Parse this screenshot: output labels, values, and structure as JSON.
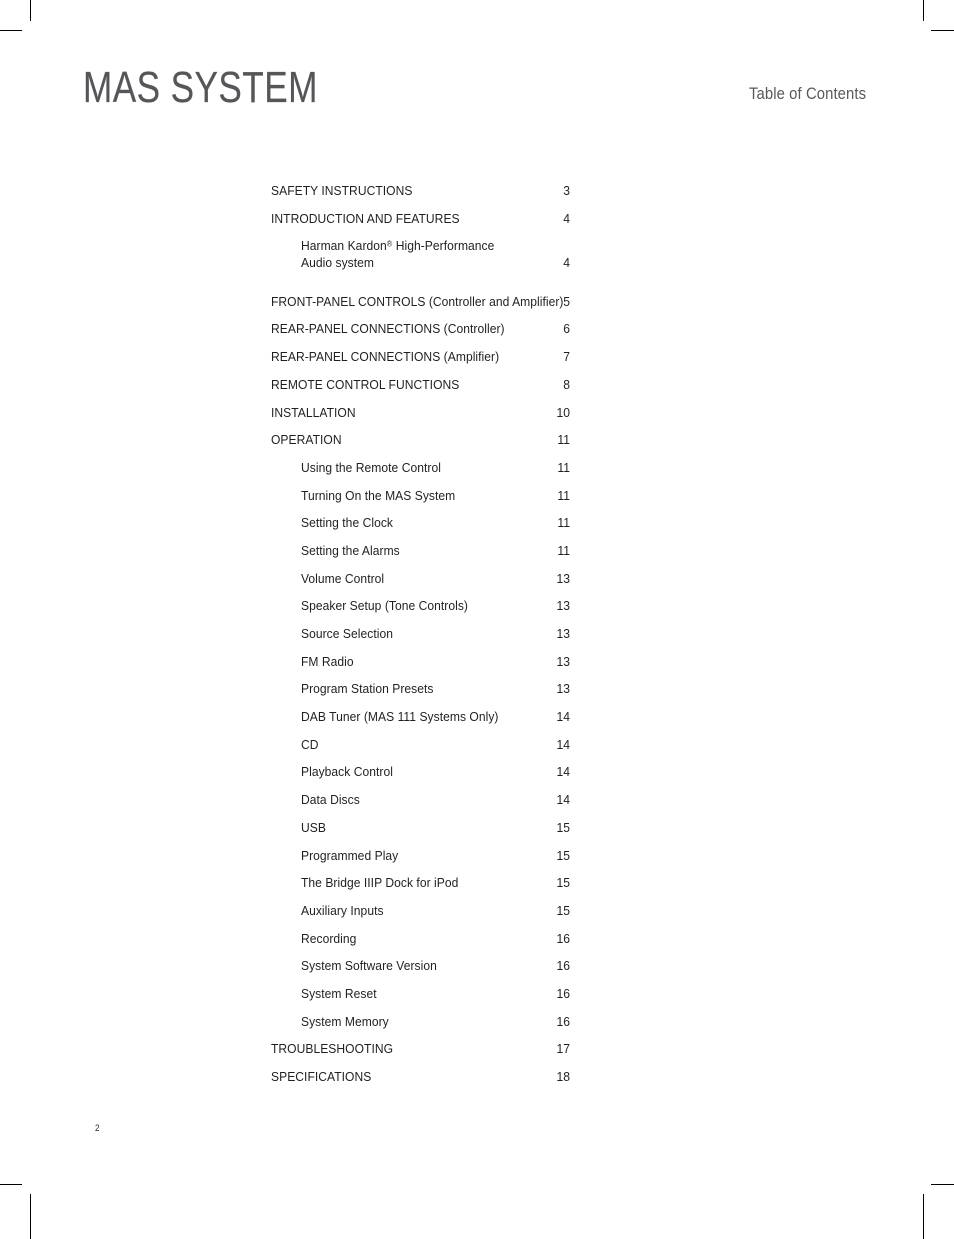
{
  "document": {
    "brand_title": "MAS SYSTEM",
    "section_kicker": "Table of Contents",
    "folio": "2"
  },
  "toc": {
    "entries": [
      {
        "label": "SAFETY INSTRUCTIONS",
        "page": "3",
        "level": "main",
        "lines": 1
      },
      {
        "label": "INTRODUCTION AND FEATURES",
        "page": "4",
        "level": "main",
        "lines": 1
      },
      {
        "label": "Harman Kardon<sup>®</sup> High-Performance\nAudio system",
        "page": "4",
        "level": "sub",
        "lines": 2
      },
      {
        "label": "FRONT-PANEL CONTROLS (Controller and Amplifier)",
        "page": "5",
        "level": "main",
        "lines": 1
      },
      {
        "label": "REAR-PANEL CONNECTIONS (Controller)",
        "page": "6",
        "level": "main",
        "lines": 1
      },
      {
        "label": "REAR-PANEL CONNECTIONS (Amplifier)",
        "page": "7",
        "level": "main",
        "lines": 1
      },
      {
        "label": "REMOTE CONTROL FUNCTIONS",
        "page": "8",
        "level": "main",
        "lines": 1
      },
      {
        "label": "INSTALLATION",
        "page": "10",
        "level": "main",
        "lines": 1
      },
      {
        "label": "OPERATION",
        "page": "11",
        "level": "main",
        "lines": 1
      },
      {
        "label": "Using the Remote Control",
        "page": "11",
        "level": "sub",
        "lines": 1
      },
      {
        "label": "Turning On the MAS System",
        "page": "11",
        "level": "sub",
        "lines": 1
      },
      {
        "label": "Setting the Clock",
        "page": "11",
        "level": "sub",
        "lines": 1
      },
      {
        "label": "Setting the Alarms",
        "page": "11",
        "level": "sub",
        "lines": 1
      },
      {
        "label": "Volume Control",
        "page": "13",
        "level": "sub",
        "lines": 1
      },
      {
        "label": "Speaker Setup (Tone Controls)",
        "page": "13",
        "level": "sub",
        "lines": 1
      },
      {
        "label": "Source Selection",
        "page": "13",
        "level": "sub",
        "lines": 1
      },
      {
        "label": "FM Radio",
        "page": "13",
        "level": "sub",
        "lines": 1
      },
      {
        "label": "Program Station Presets",
        "page": "13",
        "level": "sub",
        "lines": 1
      },
      {
        "label": "DAB Tuner (MAS 111 Systems Only)",
        "page": "14",
        "level": "sub",
        "lines": 1
      },
      {
        "label": "CD",
        "page": "14",
        "level": "sub",
        "lines": 1
      },
      {
        "label": "Playback Control",
        "page": "14",
        "level": "sub",
        "lines": 1
      },
      {
        "label": "Data Discs",
        "page": "14",
        "level": "sub",
        "lines": 1
      },
      {
        "label": "USB",
        "page": "15",
        "level": "sub",
        "lines": 1
      },
      {
        "label": "Programmed Play",
        "page": "15",
        "level": "sub",
        "lines": 1
      },
      {
        "label": "The Bridge IIIP Dock for iPod",
        "page": "15",
        "level": "sub",
        "lines": 1
      },
      {
        "label": "Auxiliary Inputs",
        "page": "15",
        "level": "sub",
        "lines": 1
      },
      {
        "label": "Recording",
        "page": "16",
        "level": "sub",
        "lines": 1
      },
      {
        "label": "System Software Version",
        "page": "16",
        "level": "sub",
        "lines": 1
      },
      {
        "label": "System Reset",
        "page": "16",
        "level": "sub",
        "lines": 1
      },
      {
        "label": "System Memory",
        "page": "16",
        "level": "sub",
        "lines": 1
      },
      {
        "label": "TROUBLESHOOTING",
        "page": "17",
        "level": "main",
        "lines": 1
      },
      {
        "label": "SPECIFICATIONS",
        "page": "18",
        "level": "main",
        "lines": 1
      }
    ]
  },
  "colors": {
    "text": "#231f20",
    "muted": "#58595b",
    "title": "#55565a",
    "background": "#ffffff",
    "crop_mark": "#000000"
  }
}
